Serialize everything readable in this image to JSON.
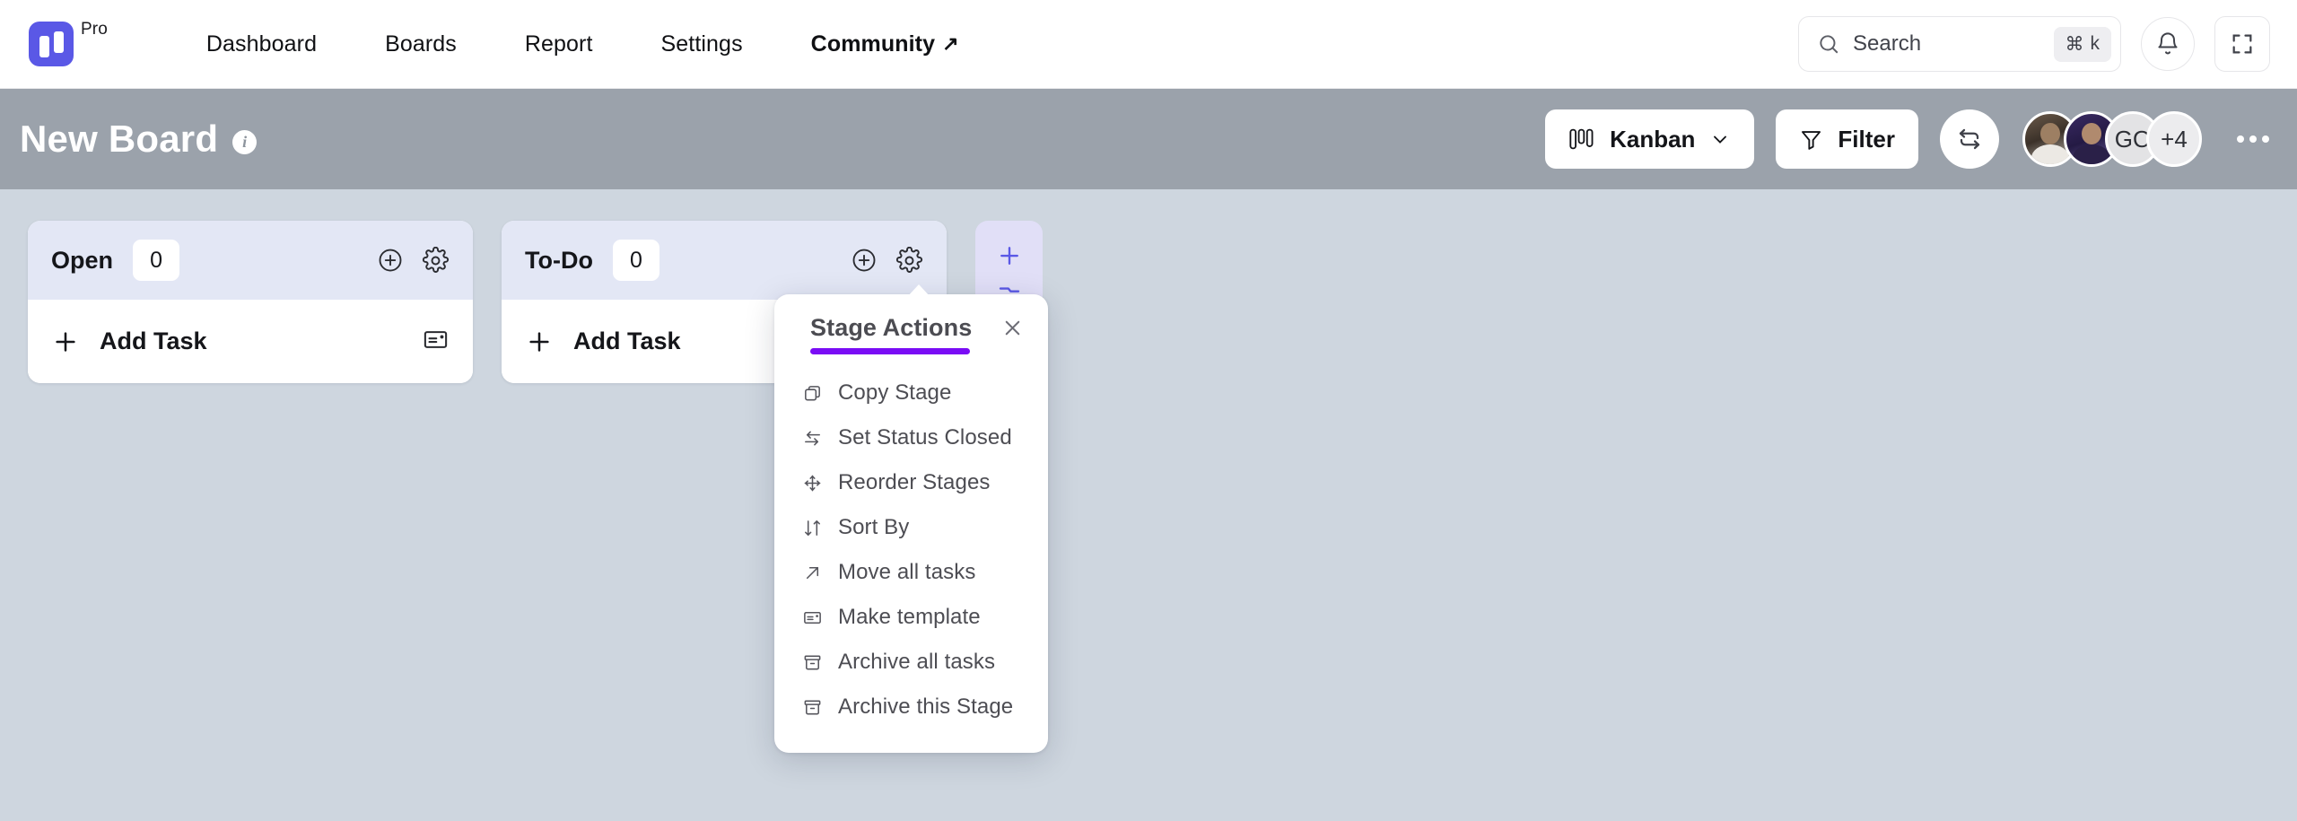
{
  "topnav": {
    "logo_name": "app-logo",
    "badge": "Pro",
    "links": [
      {
        "label": "Dashboard",
        "external": false
      },
      {
        "label": "Boards",
        "external": false
      },
      {
        "label": "Report",
        "external": false
      },
      {
        "label": "Settings",
        "external": false
      },
      {
        "label": "Community",
        "external": true,
        "ext_glyph": "↗"
      }
    ],
    "search": {
      "placeholder": "Search",
      "value": "",
      "shortcut_mod": "⌘",
      "shortcut_key": "k"
    },
    "notifications_icon": "bell-icon",
    "fullscreen_icon": "fullscreen-icon"
  },
  "boardbar": {
    "title": "New Board",
    "info_glyph": "i",
    "view_button": {
      "label": "Kanban",
      "icon": "kanban-icon",
      "chevron": "⌄"
    },
    "filter_button": {
      "label": "Filter",
      "icon": "filter-icon"
    },
    "refresh_icon": "refresh-icon",
    "avatars": [
      {
        "type": "photo",
        "name": "member-avatar-1"
      },
      {
        "type": "photo",
        "name": "member-avatar-2"
      },
      {
        "type": "initials",
        "label": "GO"
      },
      {
        "type": "more",
        "label": "+4"
      }
    ],
    "overflow_icon": "more-options-icon"
  },
  "board": {
    "columns": [
      {
        "name": "Open",
        "count": "0",
        "add_label": "Add Task"
      },
      {
        "name": "To-Do",
        "count": "0",
        "add_label": "Add Task"
      }
    ],
    "add_stage_glyph": "+"
  },
  "popup": {
    "title": "Stage Actions",
    "close_glyph": "✕",
    "accent": "#7a0cf5",
    "items": [
      {
        "label": "Copy Stage",
        "icon": "copy-icon"
      },
      {
        "label": "Set Status Closed",
        "icon": "swap-arrows-icon"
      },
      {
        "label": "Reorder Stages",
        "icon": "move-cross-icon"
      },
      {
        "label": "Sort By",
        "icon": "sort-icon"
      },
      {
        "label": "Move all tasks",
        "icon": "arrow-up-right-icon"
      },
      {
        "label": "Make template",
        "icon": "template-icon"
      },
      {
        "label": "Archive all tasks",
        "icon": "archive-icon"
      },
      {
        "label": "Archive this Stage",
        "icon": "archive-icon"
      }
    ]
  },
  "annotation": {
    "arrow_color": "#7a0cf5",
    "points_to": "stage-settings-gear"
  },
  "colors": {
    "brand": "#5a58e6",
    "accent": "#7a0cf5",
    "board_bg": "#ced6df",
    "boardbar_bg": "#9ba2ab",
    "column_header_bg": "#e3e7f5"
  }
}
